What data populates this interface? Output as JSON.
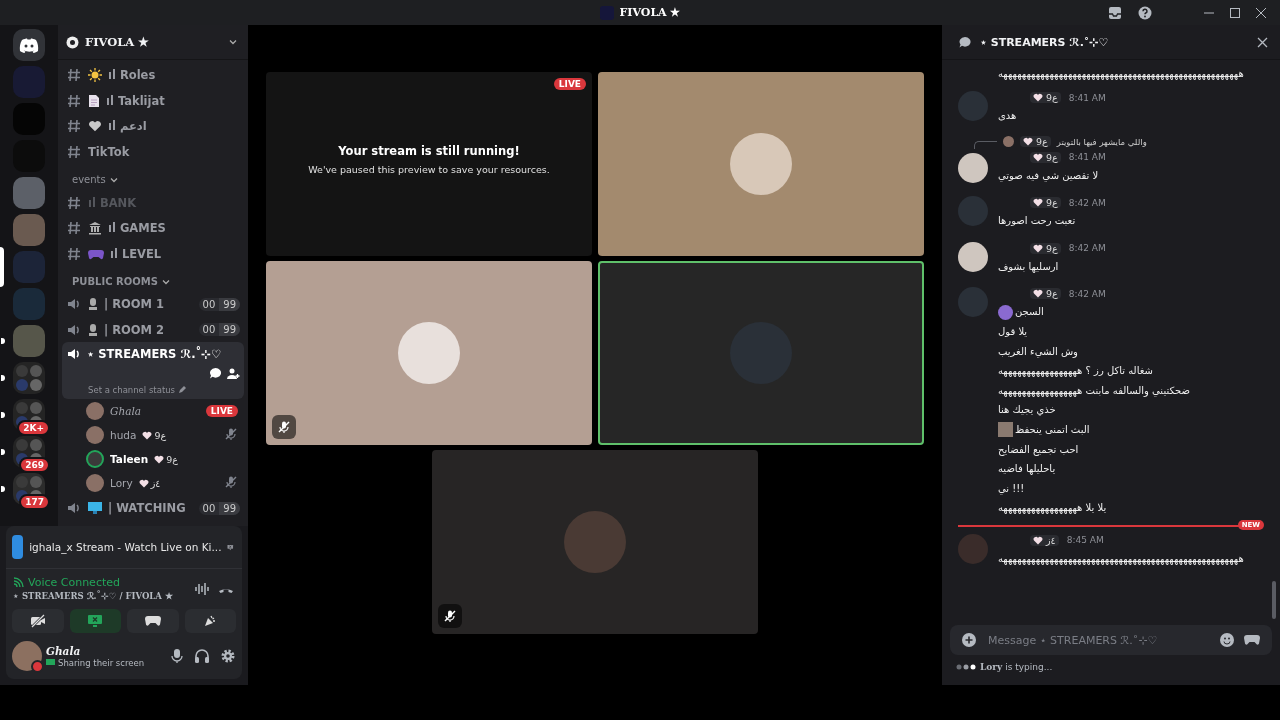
{
  "title_bar": {
    "title": "FIVOLA ★"
  },
  "servers": [
    {
      "kind": "home",
      "selected": false,
      "unread": false
    },
    {
      "kind": "server",
      "selected": false,
      "unread": false
    },
    {
      "kind": "server",
      "selected": false,
      "unread": false
    },
    {
      "kind": "server",
      "selected": false,
      "unread": false
    },
    {
      "kind": "server",
      "selected": false,
      "unread": false
    },
    {
      "kind": "server",
      "selected": false,
      "unread": false
    },
    {
      "kind": "server",
      "selected": true,
      "unread": false
    },
    {
      "kind": "server",
      "selected": false,
      "unread": false
    },
    {
      "kind": "server",
      "selected": false,
      "unread": true
    },
    {
      "kind": "folder",
      "selected": false,
      "unread": true
    },
    {
      "kind": "folder",
      "selected": false,
      "unread": true,
      "badge": "2K+"
    },
    {
      "kind": "folder",
      "selected": false,
      "unread": true,
      "badge": "269"
    },
    {
      "kind": "folder",
      "selected": false,
      "unread": true,
      "badge": "177"
    }
  ],
  "server_header": {
    "name": "FIVOLA ★"
  },
  "channels": [
    {
      "kind": "text",
      "name": "ıl Roles",
      "muted": false
    },
    {
      "kind": "text",
      "name": "ıl Taklijat",
      "muted": false
    },
    {
      "kind": "text",
      "name": "ıl ادعم",
      "muted": false
    },
    {
      "kind": "text",
      "name": "TikTok",
      "muted": false
    },
    {
      "kind": "category",
      "name": "events",
      "expanded": true
    },
    {
      "kind": "text",
      "name": "ıl BANK",
      "muted": true
    },
    {
      "kind": "text",
      "name": "ıl GAMES",
      "muted": false
    },
    {
      "kind": "text",
      "name": "ıl LEVEL",
      "muted": false
    },
    {
      "kind": "category",
      "name": "PUBLIC ROOMS",
      "expanded": true
    },
    {
      "kind": "voice",
      "name": "| ROOM 1",
      "count": "00",
      "limit": "99",
      "selected": false
    },
    {
      "kind": "voice",
      "name": "| ROOM 2",
      "count": "00",
      "limit": "99",
      "selected": false
    },
    {
      "kind": "voice",
      "name": "⋆ STREAMERS ℛ.˚⊹♡",
      "selected": true,
      "status": "Set a channel status"
    },
    {
      "kind": "user",
      "name": "Ghala",
      "live": true,
      "live_label": "LIVE",
      "muted": false,
      "speaking": false
    },
    {
      "kind": "user",
      "name": "huda",
      "badge": "9ع",
      "live": false,
      "muted": true,
      "speaking": false
    },
    {
      "kind": "user",
      "name": "Taleen",
      "badge": "9ع",
      "live": false,
      "muted": false,
      "speaking": true
    },
    {
      "kind": "user",
      "name": "Lory",
      "badge": "٤ز",
      "live": false,
      "muted": true,
      "speaking": false
    },
    {
      "kind": "voice",
      "name": "| WATCHING",
      "count": "00",
      "limit": "99",
      "selected": false
    }
  ],
  "activity": {
    "title": "ighala_x Stream - Watch Live on Ki..."
  },
  "voice": {
    "status": "Voice Connected",
    "channel": "⋆ STREAMERS ℛ.˚⊹♡ / FIVOLA ★"
  },
  "voice_buttons": [
    {
      "kind": "camera",
      "active": false
    },
    {
      "kind": "screen",
      "active": true
    },
    {
      "kind": "activity",
      "active": false
    },
    {
      "kind": "soundboard",
      "active": false
    }
  ],
  "user": {
    "name": "Ghala",
    "status": "Sharing their screen"
  },
  "tiles": [
    {
      "kind": "paused",
      "live": true,
      "live_label": "LIVE",
      "title": "Your stream is still running!",
      "subtitle": "We've paused this preview to save your resources."
    },
    {
      "kind": "camera",
      "speaking": false,
      "muted": false
    },
    {
      "kind": "camera",
      "speaking": false,
      "muted": true
    },
    {
      "kind": "camera",
      "speaking": true,
      "muted": false
    },
    {
      "kind": "camera",
      "speaking": false,
      "muted": true
    }
  ],
  "chat": {
    "title": "⋆ STREAMERS ℛ.˚⊹♡",
    "messages": [
      {
        "kind": "continuation",
        "lines": [
          {
            "kind": "text",
            "text": "ههههههههههههههههههههههههههههههههههههههههههههههههههههه"
          }
        ]
      },
      {
        "kind": "group",
        "badge": "9ع",
        "time": "8:41 AM",
        "lines": [
          {
            "kind": "text",
            "text": "هدى"
          }
        ]
      },
      {
        "kind": "group",
        "reply": {
          "badge": "9ع",
          "text": "واللي مايشهر فيها بالتويتر"
        },
        "badge": "9ع",
        "time": "8:41 AM",
        "lines": [
          {
            "kind": "text",
            "text": "لا تقصين شي فيه صوتي"
          }
        ]
      },
      {
        "kind": "group",
        "badge": "9ع",
        "time": "8:42 AM",
        "lines": [
          {
            "kind": "text",
            "text": "تعبت رحت اصورها"
          }
        ]
      },
      {
        "kind": "group",
        "badge": "9ع",
        "time": "8:42 AM",
        "lines": [
          {
            "kind": "text",
            "text": "ارسليها بشوف"
          }
        ]
      },
      {
        "kind": "group",
        "badge": "9ع",
        "time": "8:42 AM",
        "lines": [
          {
            "kind": "emoji",
            "text": "السجن"
          },
          {
            "kind": "text",
            "text": "يلا قول"
          },
          {
            "kind": "text",
            "text": "وش الشيء الغريب"
          },
          {
            "kind": "text",
            "text": "شغاله تاكل رز ؟ هههههههههههههههههه"
          },
          {
            "kind": "text",
            "text": "ضحكتيني والسالفه مابنت هههههههههههههههههه"
          },
          {
            "kind": "text",
            "text": "خذي يجيك هنا"
          },
          {
            "kind": "image",
            "text": "البث اتمنى ينحفظ"
          },
          {
            "kind": "text",
            "text": "احب تجميع الفضايح"
          },
          {
            "kind": "text",
            "text": "ياحليلها فاضيه"
          },
          {
            "kind": "text",
            "text": "ني !!!"
          },
          {
            "kind": "text",
            "text": "يلا يلا هههههههههههههههههه"
          }
        ]
      },
      {
        "kind": "divider",
        "label": "NEW"
      },
      {
        "kind": "group",
        "badge": "٤ز",
        "time": "8:45 AM",
        "lines": [
          {
            "kind": "text",
            "text": "ههههههههههههههههههههههههههههههههههههههههههههههههههههه"
          }
        ]
      }
    ],
    "input": {
      "placeholder": "Message ⋆ STREAMERS ℛ.˚⊹♡"
    },
    "typing": "**Lory** is typing..."
  }
}
